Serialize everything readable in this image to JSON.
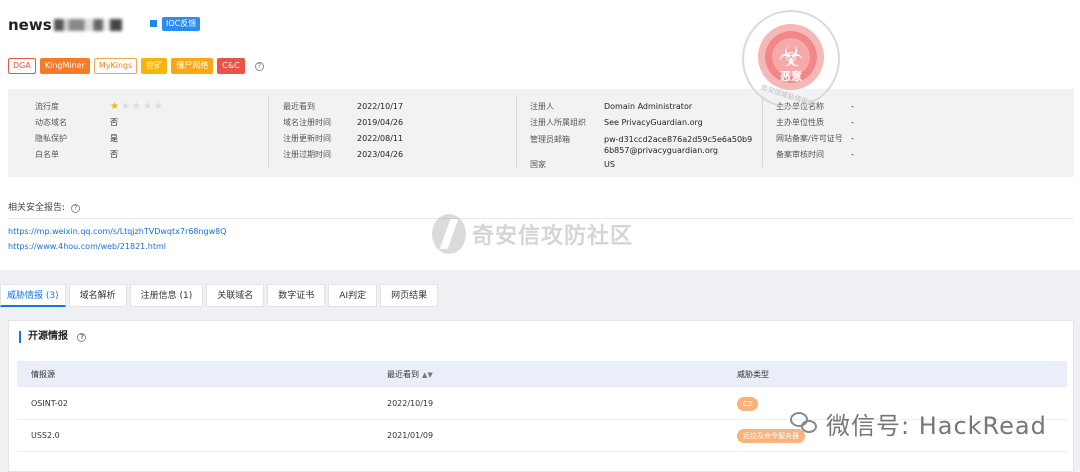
{
  "header": {
    "domain_prefix": "news",
    "ioc_button": "IOC反馈"
  },
  "tags": [
    "DGA",
    "KingMiner",
    "MyKings",
    "挖矿",
    "僵尸网络",
    "C&C"
  ],
  "info": {
    "col1": [
      {
        "label": "流行度",
        "value": ""
      },
      {
        "label": "动态域名",
        "value": "否"
      },
      {
        "label": "隐私保护",
        "value": "是"
      },
      {
        "label": "白名单",
        "value": "否"
      }
    ],
    "popularity_stars": 1,
    "popularity_max": 5,
    "col2": [
      {
        "label": "最近看到",
        "value": "2022/10/17"
      },
      {
        "label": "域名注册时间",
        "value": "2019/04/26"
      },
      {
        "label": "注册更新时间",
        "value": "2022/08/11"
      },
      {
        "label": "注册过期时间",
        "value": "2023/04/26"
      }
    ],
    "col3": [
      {
        "label": "注册人",
        "value": "Domain Administrator"
      },
      {
        "label": "注册人所属组织",
        "value": "See PrivacyGuardian.org"
      },
      {
        "label": "管理员邮箱",
        "value": "pw-d31ccd2ace876a2d59c5e6a50b96b857@privacyguardian.org"
      },
      {
        "label": "国家",
        "value": "US"
      }
    ],
    "col4": [
      {
        "label": "主办单位名称",
        "value": "-"
      },
      {
        "label": "主办单位性质",
        "value": "-"
      },
      {
        "label": "网站备案/许可证号",
        "value": "-"
      },
      {
        "label": "备案审核时间",
        "value": "-"
      }
    ]
  },
  "stamp": {
    "word": "恶意",
    "ring": "奇安信威胁情报中心"
  },
  "reports": {
    "title": "相关安全报告:",
    "links": [
      "https://mp.weixin.qq.com/s/LtqjzhTVDwqtx7r68ngw8Q",
      "https://www.4hou.com/web/21821.html"
    ]
  },
  "watermark": "奇安信攻防社区",
  "tabs": [
    "威胁情报 (3)",
    "域名解析",
    "注册信息 (1)",
    "关联域名",
    "数字证书",
    "AI判定",
    "网页结果"
  ],
  "section": {
    "title": "开源情报",
    "columns": [
      "情报源",
      "最近看到",
      "威胁类型"
    ],
    "rows": [
      {
        "source": "OSINT-02",
        "seen": "2022/10/19",
        "type": "C2"
      },
      {
        "source": "USS2.0",
        "seen": "2021/01/09",
        "type": "远控及命令服务器"
      }
    ]
  },
  "wechat_watermark": "微信号: HackRead"
}
